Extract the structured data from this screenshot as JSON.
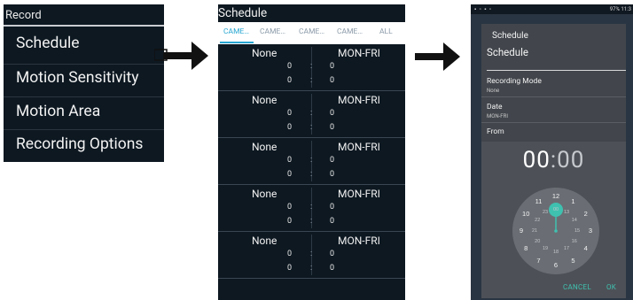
{
  "panel1": {
    "header": "Record",
    "items": [
      "Schedule",
      "Motion Sensitivity",
      "Motion Area",
      "Recording Options"
    ]
  },
  "panel2": {
    "title": "Schedule",
    "tabs": [
      "CAME…",
      "CAME…",
      "CAME…",
      "CAME…",
      "ALL"
    ],
    "active_tab": 0,
    "rows": [
      {
        "mode": "None",
        "days": "MON-FRI",
        "start": [
          "0",
          "0"
        ],
        "end": [
          "0",
          "0"
        ]
      },
      {
        "mode": "None",
        "days": "MON-FRI",
        "start": [
          "0",
          "0"
        ],
        "end": [
          "0",
          "0"
        ]
      },
      {
        "mode": "None",
        "days": "MON-FRI",
        "start": [
          "0",
          "0"
        ],
        "end": [
          "0",
          "0"
        ]
      },
      {
        "mode": "None",
        "days": "MON-FRI",
        "start": [
          "0",
          "0"
        ],
        "end": [
          "0",
          "0"
        ]
      },
      {
        "mode": "None",
        "days": "MON-FRI",
        "start": [
          "0",
          "0"
        ],
        "end": [
          "0",
          "0"
        ]
      }
    ],
    "separator": ":"
  },
  "panel3": {
    "status_bar": "97% 11:3",
    "dialog": {
      "title": "Schedule",
      "subtitle": "Schedule",
      "recording_mode_label": "Recording Mode",
      "recording_mode_value": "None",
      "date_label": "Date",
      "date_value": "MON-FRI",
      "from_label": "From",
      "time_hours": "00",
      "time_sep": ":",
      "time_minutes": "00",
      "clock_outer": [
        "12",
        "1",
        "2",
        "3",
        "4",
        "5",
        "6",
        "7",
        "8",
        "9",
        "10",
        "11"
      ],
      "clock_inner": [
        "00",
        "13",
        "14",
        "15",
        "16",
        "17",
        "18",
        "19",
        "20",
        "21",
        "22",
        "23"
      ],
      "cancel_label": "CANCEL",
      "ok_label": "OK"
    }
  },
  "colors": {
    "dark_bg": "#0d1821",
    "accent_blue": "#26a6d1",
    "accent_teal": "#3fc1b0"
  }
}
